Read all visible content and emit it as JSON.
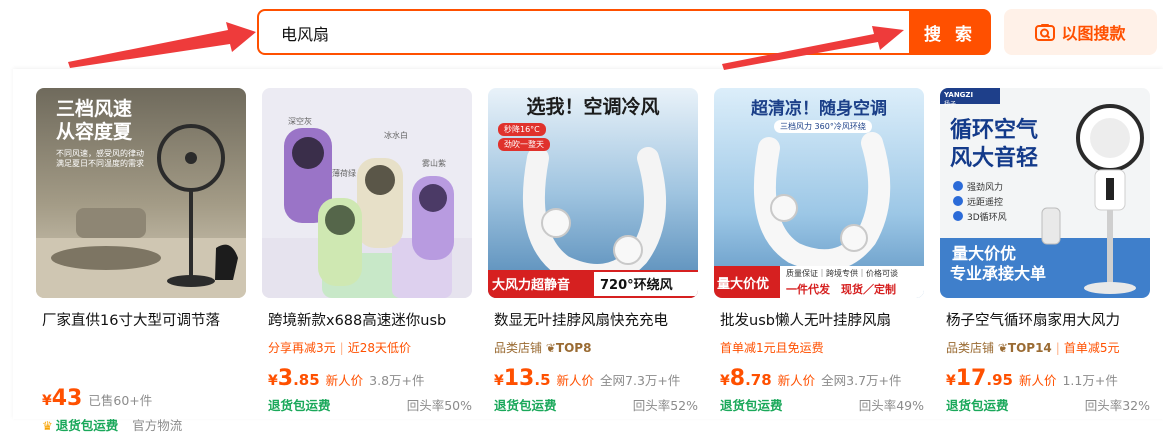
{
  "search": {
    "query": "电风扇",
    "button_label": "搜 索",
    "image_search_label": "以图搜款"
  },
  "products": [
    {
      "title": "厂家直供16寸大型可调节落",
      "image_caption_main": "三档风速",
      "image_caption_sub": "从容度夏",
      "image_caption_small": "不同风速，感受风的律动",
      "image_caption_small2": "满足夏日不同温度的需求",
      "price_int": "43",
      "price_dec": "",
      "price_tag": "",
      "sold": "已售60+件",
      "ship": "退货包运费",
      "right_text": "官方物流",
      "has_crown": true
    },
    {
      "title": "跨境新款x688高速迷你usb",
      "promo1": "分享再减3元",
      "promo2": "近28天低价",
      "image_labels": [
        "深空灰",
        "冰水白",
        "薄荷绿",
        "雾山紫"
      ],
      "price_int": "3",
      "price_dec": ".85",
      "price_tag": "新人价",
      "sold": "3.8万+件",
      "ship": "退货包运费",
      "right_text": "回头率50%"
    },
    {
      "title": "数显无叶挂脖风扇快充充电",
      "store": "品类店铺",
      "store_rank": "TOP8",
      "image_caption_main": "选我！空调冷风",
      "image_badge1": "秒降16°C",
      "image_badge2": "劲吹一整天",
      "image_banner": "大风力超静音",
      "image_banner2": "720°环绕风",
      "price_int": "13",
      "price_dec": ".5",
      "price_tag": "新人价",
      "sold": "全网7.3万+件",
      "ship": "退货包运费",
      "right_text": "回头率52%"
    },
    {
      "title": "批发usb懒人无叶挂脖风扇",
      "promo1": "首单减1元且免运费",
      "image_caption_main": "超清凉！随身空调",
      "image_tag": "三档风力",
      "image_tag2": "360°冷风环绕",
      "image_banner": "量大价优",
      "image_banner_sub1": "质量保证｜跨境专供｜价格可谈",
      "image_banner_sub2": "一件代发　现货／定制",
      "price_int": "8",
      "price_dec": ".78",
      "price_tag": "新人价",
      "sold": "全网3.7万+件",
      "ship": "退货包运费",
      "right_text": "回头率49%"
    },
    {
      "title": "杨子空气循环扇家用大风力",
      "store": "品类店铺",
      "store_rank": "TOP14",
      "promo2": "首单减5元",
      "image_brand": "YANGZI",
      "image_brand_sub": "杨子",
      "image_caption_main": "循环空气",
      "image_caption_main2": "风大音轻",
      "image_features": [
        "强劲风力",
        "远距遥控",
        "3D循环风"
      ],
      "image_caption_bottom": "量大价优",
      "image_caption_bottom2": "专业承接大单",
      "price_int": "17",
      "price_dec": ".95",
      "price_tag": "新人价",
      "sold": "1.1万+件",
      "ship": "退货包运费",
      "right_text": "回头率32%"
    }
  ],
  "currency": "¥",
  "colors": {
    "accent": "#ff5000",
    "ship": "#1aa85a",
    "arrow": "#ee3b3b"
  }
}
